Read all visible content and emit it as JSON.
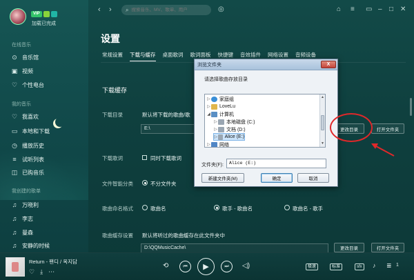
{
  "user": {
    "status": "加载已完成",
    "badges": [
      "VIP",
      "",
      ""
    ]
  },
  "sidebar": {
    "online_title": "在线音乐",
    "online_items": [
      {
        "label": "音乐馆",
        "icon": "music-hall-icon"
      },
      {
        "label": "视频",
        "icon": "video-icon"
      },
      {
        "label": "个性电台",
        "icon": "radio-icon"
      }
    ],
    "mine_title": "我的音乐",
    "mine_items": [
      {
        "label": "我喜欢",
        "icon": "heart-icon"
      },
      {
        "label": "本地和下载",
        "icon": "computer-icon"
      },
      {
        "label": "播放历史",
        "icon": "history-icon"
      },
      {
        "label": "试听列表",
        "icon": "list-icon"
      },
      {
        "label": "已购音乐",
        "icon": "bag-icon"
      }
    ],
    "created_title": "我创建的歌单",
    "created_items": [
      {
        "label": "万晓利",
        "icon": "playlist-icon"
      },
      {
        "label": "李志",
        "icon": "playlist-icon"
      },
      {
        "label": "曼森",
        "icon": "playlist-icon"
      },
      {
        "label": "安静的时候",
        "icon": "playlist-icon"
      }
    ]
  },
  "topbar": {
    "search_placeholder": "搜索音乐、MV、歌单、用户"
  },
  "page": {
    "title": "设置",
    "tabs": [
      "常规设置",
      "下载与缓存",
      "桌面歌词",
      "歌词面板",
      "快捷键",
      "音效插件",
      "网络设置",
      "音频设备"
    ],
    "active_tab": 1,
    "section_title": "下载缓存",
    "download_dir_label": "下载目录",
    "download_dir_desc": "默认将下载的歌曲/歌",
    "download_dir_value": "E:\\",
    "change_dir_button": "更改目录",
    "open_folder_button": "打开文件夹",
    "download_lyrics_label": "下载歌词",
    "download_lyrics_option": "同时下载歌词",
    "classify_label": "文件智能分类",
    "classify_option": "不分文件夹",
    "naming_label": "歌曲命名格式",
    "naming_options": [
      "歌曲名",
      "歌手 - 歌曲名",
      "歌曲名 - 歌手"
    ],
    "naming_selected": 1,
    "cache_label": "歌曲缓存设置",
    "cache_desc": "默认将听过的歌曲缓存在此文件夹中",
    "cache_dir_value": "D:\\QQMusicCache\\",
    "cache_change_button": "更改目录",
    "cache_open_button": "打开文件夹"
  },
  "dialog": {
    "title": "浏览文件夹",
    "close": "X",
    "prompt": "请选择歌曲存放目录",
    "tree": [
      {
        "label": "家庭组",
        "indent": 0,
        "expander": "▷",
        "icon": "homegroup-icon",
        "color": "#3a8fd8"
      },
      {
        "label": "LoveLu",
        "indent": 0,
        "expander": "▷",
        "icon": "user-folder-icon",
        "color": "#e0b64c"
      },
      {
        "label": "计算机",
        "indent": 0,
        "expander": "◢",
        "icon": "computer-icon",
        "color": "#5a8fc4"
      },
      {
        "label": "本地磁盘 (C:)",
        "indent": 1,
        "expander": "▷",
        "icon": "drive-icon",
        "color": "#9aa6b2"
      },
      {
        "label": "文档 (D:)",
        "indent": 1,
        "expander": "▷",
        "icon": "drive-icon",
        "color": "#9aa6b2"
      },
      {
        "label": "Alice (E:)",
        "indent": 1,
        "expander": "▷",
        "icon": "drive-icon",
        "color": "#9aa6b2",
        "selected": true
      },
      {
        "label": "网络",
        "indent": 0,
        "expander": "▷",
        "icon": "network-icon",
        "color": "#4f86c6"
      }
    ],
    "folder_label": "文件夹(F):",
    "folder_value": "Alice (E:)",
    "new_folder_button": "新建文件夹(M)",
    "ok_button": "确定",
    "cancel_button": "取消"
  },
  "player": {
    "song": "Return - 팬디 / 옥지담",
    "quality": "极速",
    "quality2": "标准",
    "effect": "sfx",
    "count": "1"
  },
  "colors": {
    "accent_annotation": "#e0282a",
    "bg_teal": "#124a48"
  }
}
